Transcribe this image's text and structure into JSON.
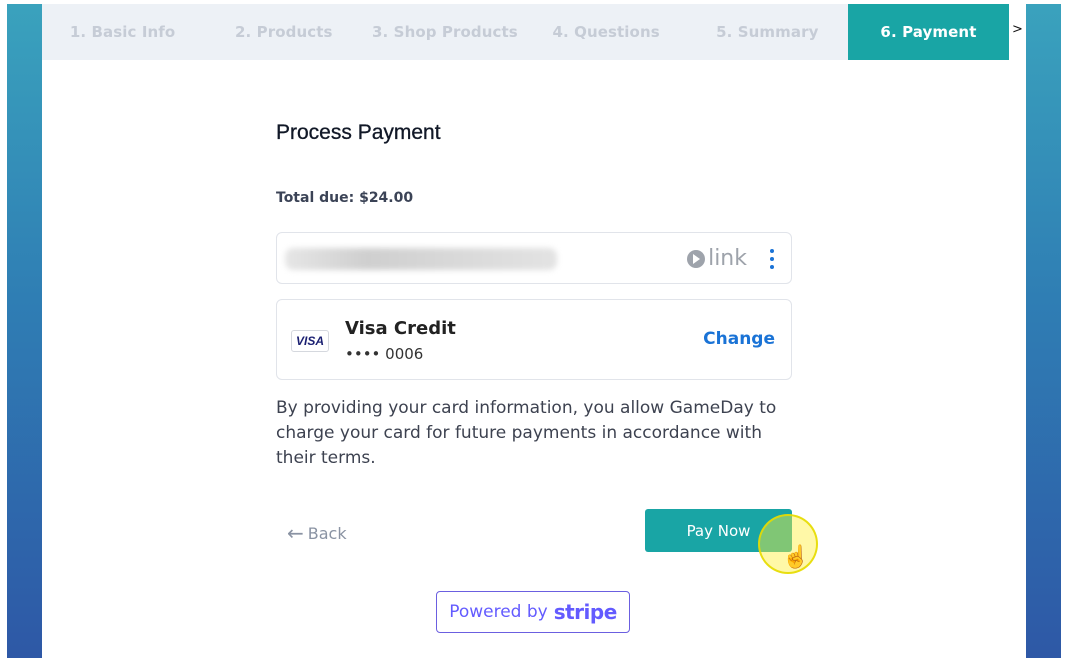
{
  "stepper": {
    "steps": [
      "1. Basic Info",
      "2. Products",
      "3. Shop Products",
      "4. Questions",
      "5. Summary",
      "6. Payment"
    ],
    "active_index": 5,
    "more_arrow": ">"
  },
  "payment": {
    "title": "Process Payment",
    "total_due": "Total due: $24.00",
    "link": {
      "logo_text": "link",
      "icon": "link-play-icon",
      "menu_icon": "kebab-menu-icon"
    },
    "card": {
      "brand_logo": "VISA",
      "name": "Visa Credit",
      "number": "•••• 0006",
      "change_label": "Change"
    },
    "terms": "By providing your card information, you allow GameDay to charge your card for future payments in accordance with their terms.",
    "back_label": "Back",
    "back_icon": "arrow-left-icon",
    "pay_label": "Pay Now",
    "powered_prefix": "Powered by",
    "powered_brand": "stripe"
  },
  "colors": {
    "accent": "#19a5a5",
    "link_blue": "#1a73d6",
    "stripe_purple": "#635bff",
    "step_inactive": "#c6ccd6",
    "band_gradient": [
      "#3aa2bd",
      "#2e58a6"
    ]
  }
}
